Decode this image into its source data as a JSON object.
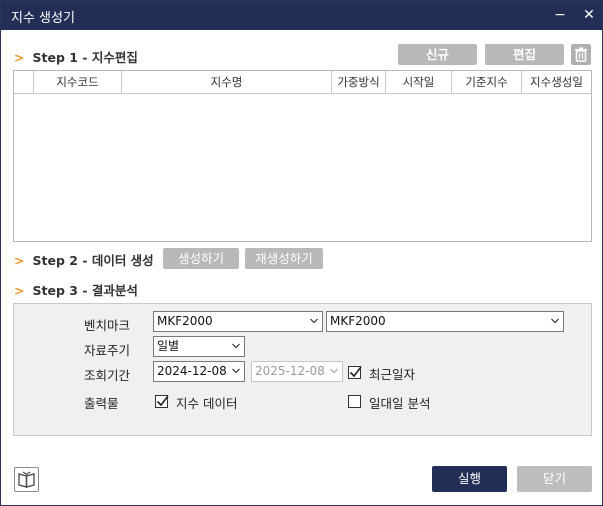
{
  "window": {
    "title": "지수 생성기",
    "minimize_glyph": "−",
    "close_glyph": "✕"
  },
  "step1": {
    "label": "Step 1 - 지수편집",
    "new_button": "신규",
    "edit_button": "편집",
    "delete_icon": "trash-icon",
    "columns": [
      "",
      "지수코드",
      "지수명",
      "가중방식",
      "시작일",
      "기준지수",
      "지수생성일"
    ]
  },
  "step2": {
    "label": "Step 2 - 데이터 생성",
    "generate_button": "생성하기",
    "regenerate_button": "재생성하기"
  },
  "step3": {
    "label": "Step 3 - 결과분석",
    "benchmark_label": "벤치마크",
    "benchmark_value_1": "MKF2000",
    "benchmark_value_2": "MKF2000",
    "frequency_label": "자료주기",
    "frequency_value": "일별",
    "period_label": "조회기간",
    "start_date": "2024-12-08",
    "end_date": "2025-12-08",
    "recent_date_label": "최근일자",
    "recent_date_checked": true,
    "output_label": "출력물",
    "index_data_label": "지수 데이터",
    "index_data_checked": true,
    "daily_analysis_label": "일대일 분석",
    "daily_analysis_checked": false
  },
  "footer": {
    "book_icon": "book-icon",
    "run_button": "실행",
    "close_button": "닫기"
  },
  "colors": {
    "titlebar": "#232e56",
    "accent_chevron": "#e89a2a",
    "gray_button": "#b8b8b8",
    "primary_button": "#232e56"
  }
}
